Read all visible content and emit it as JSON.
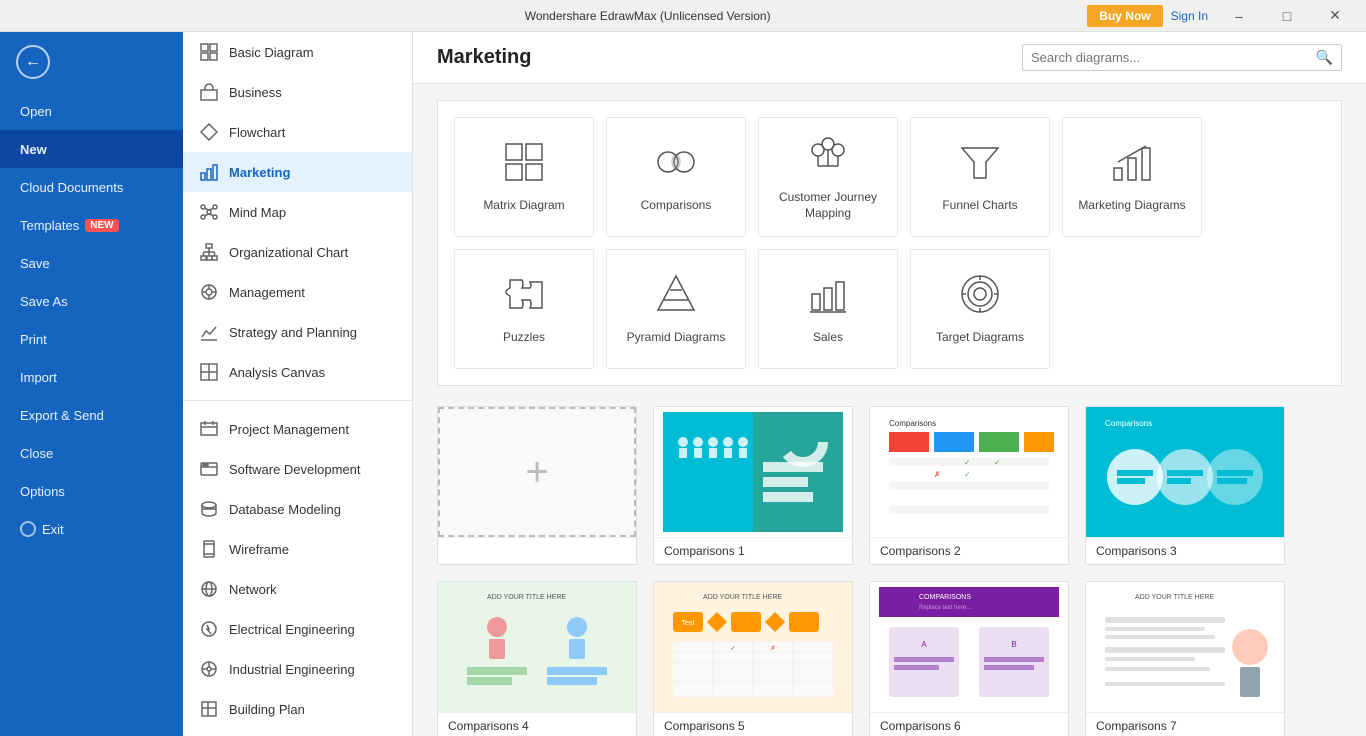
{
  "titlebar": {
    "title": "Wondershare EdrawMax (Unlicensed Version)",
    "buy_now": "Buy Now",
    "sign_in": "Sign In"
  },
  "sidebar": {
    "items": [
      {
        "id": "open",
        "label": "Open"
      },
      {
        "id": "new",
        "label": "New",
        "active": true
      },
      {
        "id": "cloud",
        "label": "Cloud Documents"
      },
      {
        "id": "templates",
        "label": "Templates",
        "badge": "NEW"
      },
      {
        "id": "save",
        "label": "Save"
      },
      {
        "id": "save-as",
        "label": "Save As"
      },
      {
        "id": "print",
        "label": "Print"
      },
      {
        "id": "import",
        "label": "Import"
      },
      {
        "id": "export",
        "label": "Export & Send"
      },
      {
        "id": "close",
        "label": "Close"
      },
      {
        "id": "options",
        "label": "Options"
      },
      {
        "id": "exit",
        "label": "Exit"
      }
    ]
  },
  "categories": {
    "items": [
      {
        "id": "basic-diagram",
        "label": "Basic Diagram",
        "icon": "□"
      },
      {
        "id": "business",
        "label": "Business",
        "icon": "💼"
      },
      {
        "id": "flowchart",
        "label": "Flowchart",
        "icon": "⬡"
      },
      {
        "id": "marketing",
        "label": "Marketing",
        "active": true,
        "icon": "📊"
      },
      {
        "id": "mind-map",
        "label": "Mind Map",
        "icon": "🧠"
      },
      {
        "id": "org-chart",
        "label": "Organizational Chart",
        "icon": "🏢"
      },
      {
        "id": "management",
        "label": "Management",
        "icon": "⚙️"
      },
      {
        "id": "strategy",
        "label": "Strategy and Planning",
        "icon": "📈"
      },
      {
        "id": "analysis",
        "label": "Analysis Canvas",
        "icon": "⬛"
      },
      {
        "id": "project-mgmt",
        "label": "Project Management",
        "icon": "📋"
      },
      {
        "id": "software-dev",
        "label": "Software Development",
        "icon": "🖥️"
      },
      {
        "id": "database",
        "label": "Database Modeling",
        "icon": "🗄️"
      },
      {
        "id": "wireframe",
        "label": "Wireframe",
        "icon": "📱"
      },
      {
        "id": "network",
        "label": "Network",
        "icon": "🌐"
      },
      {
        "id": "electrical",
        "label": "Electrical Engineering",
        "icon": "⚡"
      },
      {
        "id": "industrial",
        "label": "Industrial Engineering",
        "icon": "🔧"
      },
      {
        "id": "building",
        "label": "Building Plan",
        "icon": "🏗️"
      }
    ]
  },
  "main": {
    "title": "Marketing",
    "search_placeholder": "Search diagrams...",
    "category_cards": [
      {
        "id": "matrix",
        "label": "Matrix Diagram"
      },
      {
        "id": "comparisons",
        "label": "Comparisons"
      },
      {
        "id": "customer-journey",
        "label": "Customer Journey Mapping"
      },
      {
        "id": "funnel",
        "label": "Funnel Charts"
      },
      {
        "id": "marketing-diag",
        "label": "Marketing Diagrams"
      },
      {
        "id": "puzzles",
        "label": "Puzzles"
      },
      {
        "id": "pyramid",
        "label": "Pyramid Diagrams"
      },
      {
        "id": "sales",
        "label": "Sales"
      },
      {
        "id": "target",
        "label": "Target Diagrams"
      }
    ],
    "templates": [
      {
        "id": "new",
        "label": "",
        "type": "new"
      },
      {
        "id": "comp1",
        "label": "Comparisons 1",
        "type": "comp1"
      },
      {
        "id": "comp2",
        "label": "Comparisons 2",
        "type": "comp2"
      },
      {
        "id": "comp3",
        "label": "Comparisons 3",
        "type": "comp3"
      },
      {
        "id": "comp4",
        "label": "Comparisons 4",
        "type": "comp4"
      },
      {
        "id": "comp5",
        "label": "Comparisons 5",
        "type": "comp5"
      },
      {
        "id": "comp6",
        "label": "Comparisons 6",
        "type": "comp6"
      }
    ]
  }
}
